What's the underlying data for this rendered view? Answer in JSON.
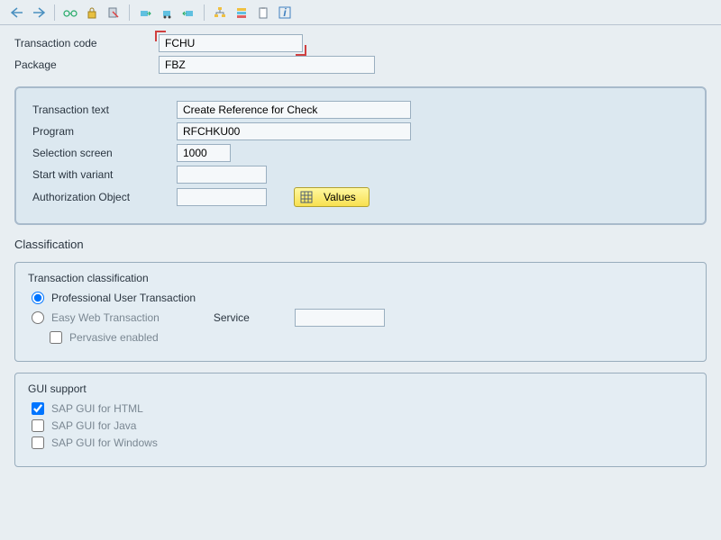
{
  "toolbar": {
    "icons": [
      "back",
      "forward",
      "glasses",
      "lock",
      "paste",
      "transport-left",
      "transport",
      "transport-right",
      "hierarchy",
      "stack",
      "clipboard",
      "info"
    ]
  },
  "header": {
    "transaction_code_label": "Transaction code",
    "transaction_code_value": "FCHU",
    "package_label": "Package",
    "package_value": "FBZ"
  },
  "details": {
    "transaction_text_label": "Transaction text",
    "transaction_text_value": "Create Reference for Check",
    "program_label": "Program",
    "program_value": "RFCHKU00",
    "selection_screen_label": "Selection screen",
    "selection_screen_value": "1000",
    "start_with_variant_label": "Start with variant",
    "start_with_variant_value": "",
    "authorization_object_label": "Authorization Object",
    "authorization_object_value": "",
    "values_button": "Values"
  },
  "classification": {
    "title": "Classification",
    "transaction_classification": {
      "title": "Transaction classification",
      "professional": "Professional User Transaction",
      "easy_web": "Easy Web Transaction",
      "service_label": "Service",
      "service_value": "",
      "pervasive": "Pervasive enabled"
    },
    "gui_support": {
      "title": "GUI support",
      "html": "SAP GUI for HTML",
      "java": "SAP GUI for Java",
      "windows": "SAP GUI for Windows"
    }
  }
}
